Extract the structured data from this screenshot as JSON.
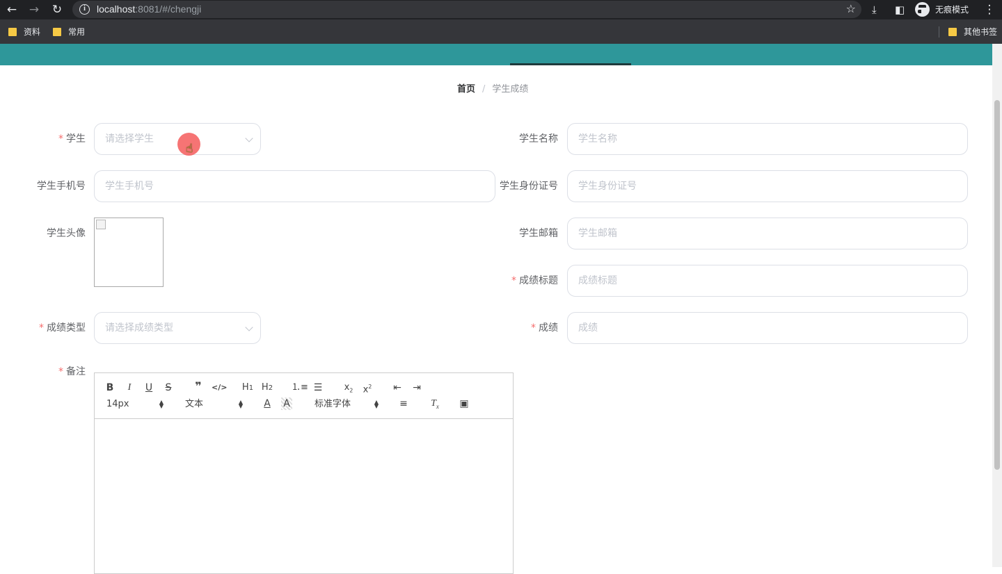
{
  "browser": {
    "url_host": "localhost",
    "url_rest": ":8081/#/chengji",
    "incognito_label": "无痕模式",
    "bookmarks": [
      "资料",
      "常用"
    ],
    "other_bookmarks": "其他书签",
    "icons": {
      "back": "arrow-left-icon",
      "forward": "arrow-right-icon",
      "reload": "reload-icon",
      "info": "info-icon",
      "star": "star-icon",
      "download": "download-icon",
      "sidepanel": "side-panel-icon",
      "menu": "more-vertical-icon"
    }
  },
  "app_nav": {
    "color": "#2e979a"
  },
  "breadcrumb": {
    "home": "首页",
    "separator": "/",
    "current": "学生成绩"
  },
  "form": {
    "student": {
      "label": "学生",
      "placeholder": "请选择学生",
      "required": true
    },
    "student_name": {
      "label": "学生名称",
      "placeholder": "学生名称"
    },
    "student_phone": {
      "label": "学生手机号",
      "placeholder": "学生手机号"
    },
    "student_id_card": {
      "label": "学生身份证号",
      "placeholder": "学生身份证号"
    },
    "student_avatar": {
      "label": "学生头像"
    },
    "student_email": {
      "label": "学生邮箱",
      "placeholder": "学生邮箱"
    },
    "score_title": {
      "label": "成绩标题",
      "placeholder": "成绩标题",
      "required": true
    },
    "score_type": {
      "label": "成绩类型",
      "placeholder": "请选择成绩类型",
      "required": true
    },
    "score": {
      "label": "成绩",
      "placeholder": "成绩",
      "required": true
    },
    "remark": {
      "label": "备注",
      "required": true
    }
  },
  "editor": {
    "toolbar_row1": [
      "B",
      "I",
      "U",
      "S",
      "99",
      "</>",
      "H1",
      "H2",
      "ordered-list",
      "bullet-list",
      "x2-sub",
      "x2-sup",
      "outdent",
      "indent"
    ],
    "size_select": "14px",
    "header_select": "文本",
    "font_select": "标准字体"
  },
  "colors": {
    "required": "#f56c6c",
    "label": "#606266",
    "placeholder": "#c0c4cc",
    "border": "#dcdfe6"
  }
}
